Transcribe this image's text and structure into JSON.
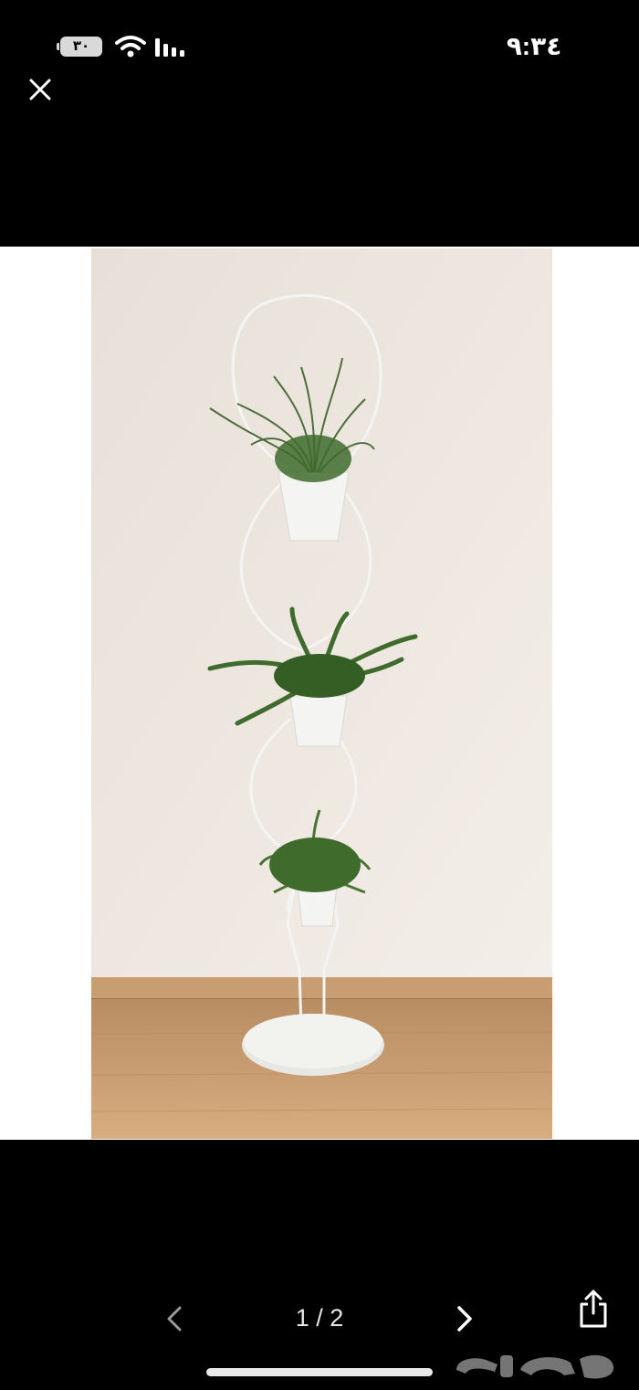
{
  "status_bar": {
    "time": "٩:٣٤",
    "battery": "٣٠"
  },
  "viewer": {
    "counter": "1 / 2"
  },
  "icons": {
    "close": "close-icon",
    "prev": "chevron-left-icon",
    "next": "chevron-right-icon",
    "share": "share-icon",
    "wifi": "wifi-icon",
    "signal": "signal-icon",
    "battery": "battery-icon"
  },
  "colors": {
    "background": "#000000",
    "viewer": "#ffffff",
    "wall": "#ece5dd",
    "floor": "#c89c72",
    "stand": "#ffffff",
    "foliage": "#3f6b2d"
  }
}
